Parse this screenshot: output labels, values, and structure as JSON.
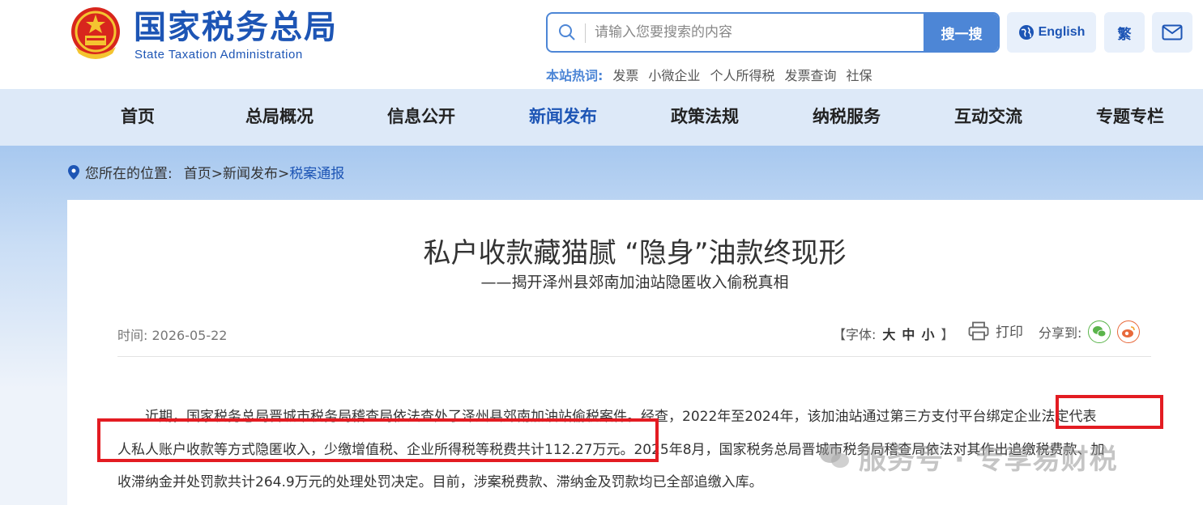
{
  "header": {
    "logo_cn": "国家税务总局",
    "logo_en": "State Taxation Administration",
    "search_placeholder": "请输入您要搜索的内容",
    "search_button": "搜一搜",
    "english_label": "English",
    "traditional_label": "繁",
    "hot_label": "本站热词:",
    "hot_words": [
      "发票",
      "小微企业",
      "个人所得税",
      "发票查询",
      "社保"
    ]
  },
  "nav": {
    "items": [
      "首页",
      "总局概况",
      "信息公开",
      "新闻发布",
      "政策法规",
      "纳税服务",
      "互动交流",
      "专题专栏"
    ],
    "active": "新闻发布"
  },
  "breadcrumb": {
    "label": "您所在的位置:",
    "home": "首页",
    "sep": ">",
    "section": "新闻发布",
    "current": "税案通报"
  },
  "article": {
    "title": "私户收款藏猫腻 “隐身”油款终现形",
    "subtitle": "——揭开泽州县郊南加油站隐匿收入偷税真相",
    "time_label": "时间:",
    "time": "2026-05-22",
    "font_label": "【字体:",
    "font_large": "大",
    "font_medium": "中",
    "font_small": "小",
    "font_close": "】",
    "print_label": "打印",
    "share_label": "分享到:",
    "lines": [
      "　　近期，国家税务总局晋城市税务局稽查局依法查处了泽州县郊南加油站偷税案件。经查，2022年至2024年，该加油站通过第三方支付平台绑定企业法定代表",
      "人私人账户收款等方式隐匿收入，少缴增值税、企业所得税等税费共计112.27万元。2025年8月，国家税务总局晋城市税务局稽查局依法对其作出追缴税费款、加",
      "收滞纳金并处罚款共计264.9万元的处理处罚决定。目前，涉案税费款、滞纳金及罚款均已全部追缴入库。"
    ]
  },
  "watermark": "服务号 · 专享易财税",
  "colors": {
    "brand": "#1d55b5",
    "accent": "#4d86d6",
    "highlight": "#e31c22"
  }
}
